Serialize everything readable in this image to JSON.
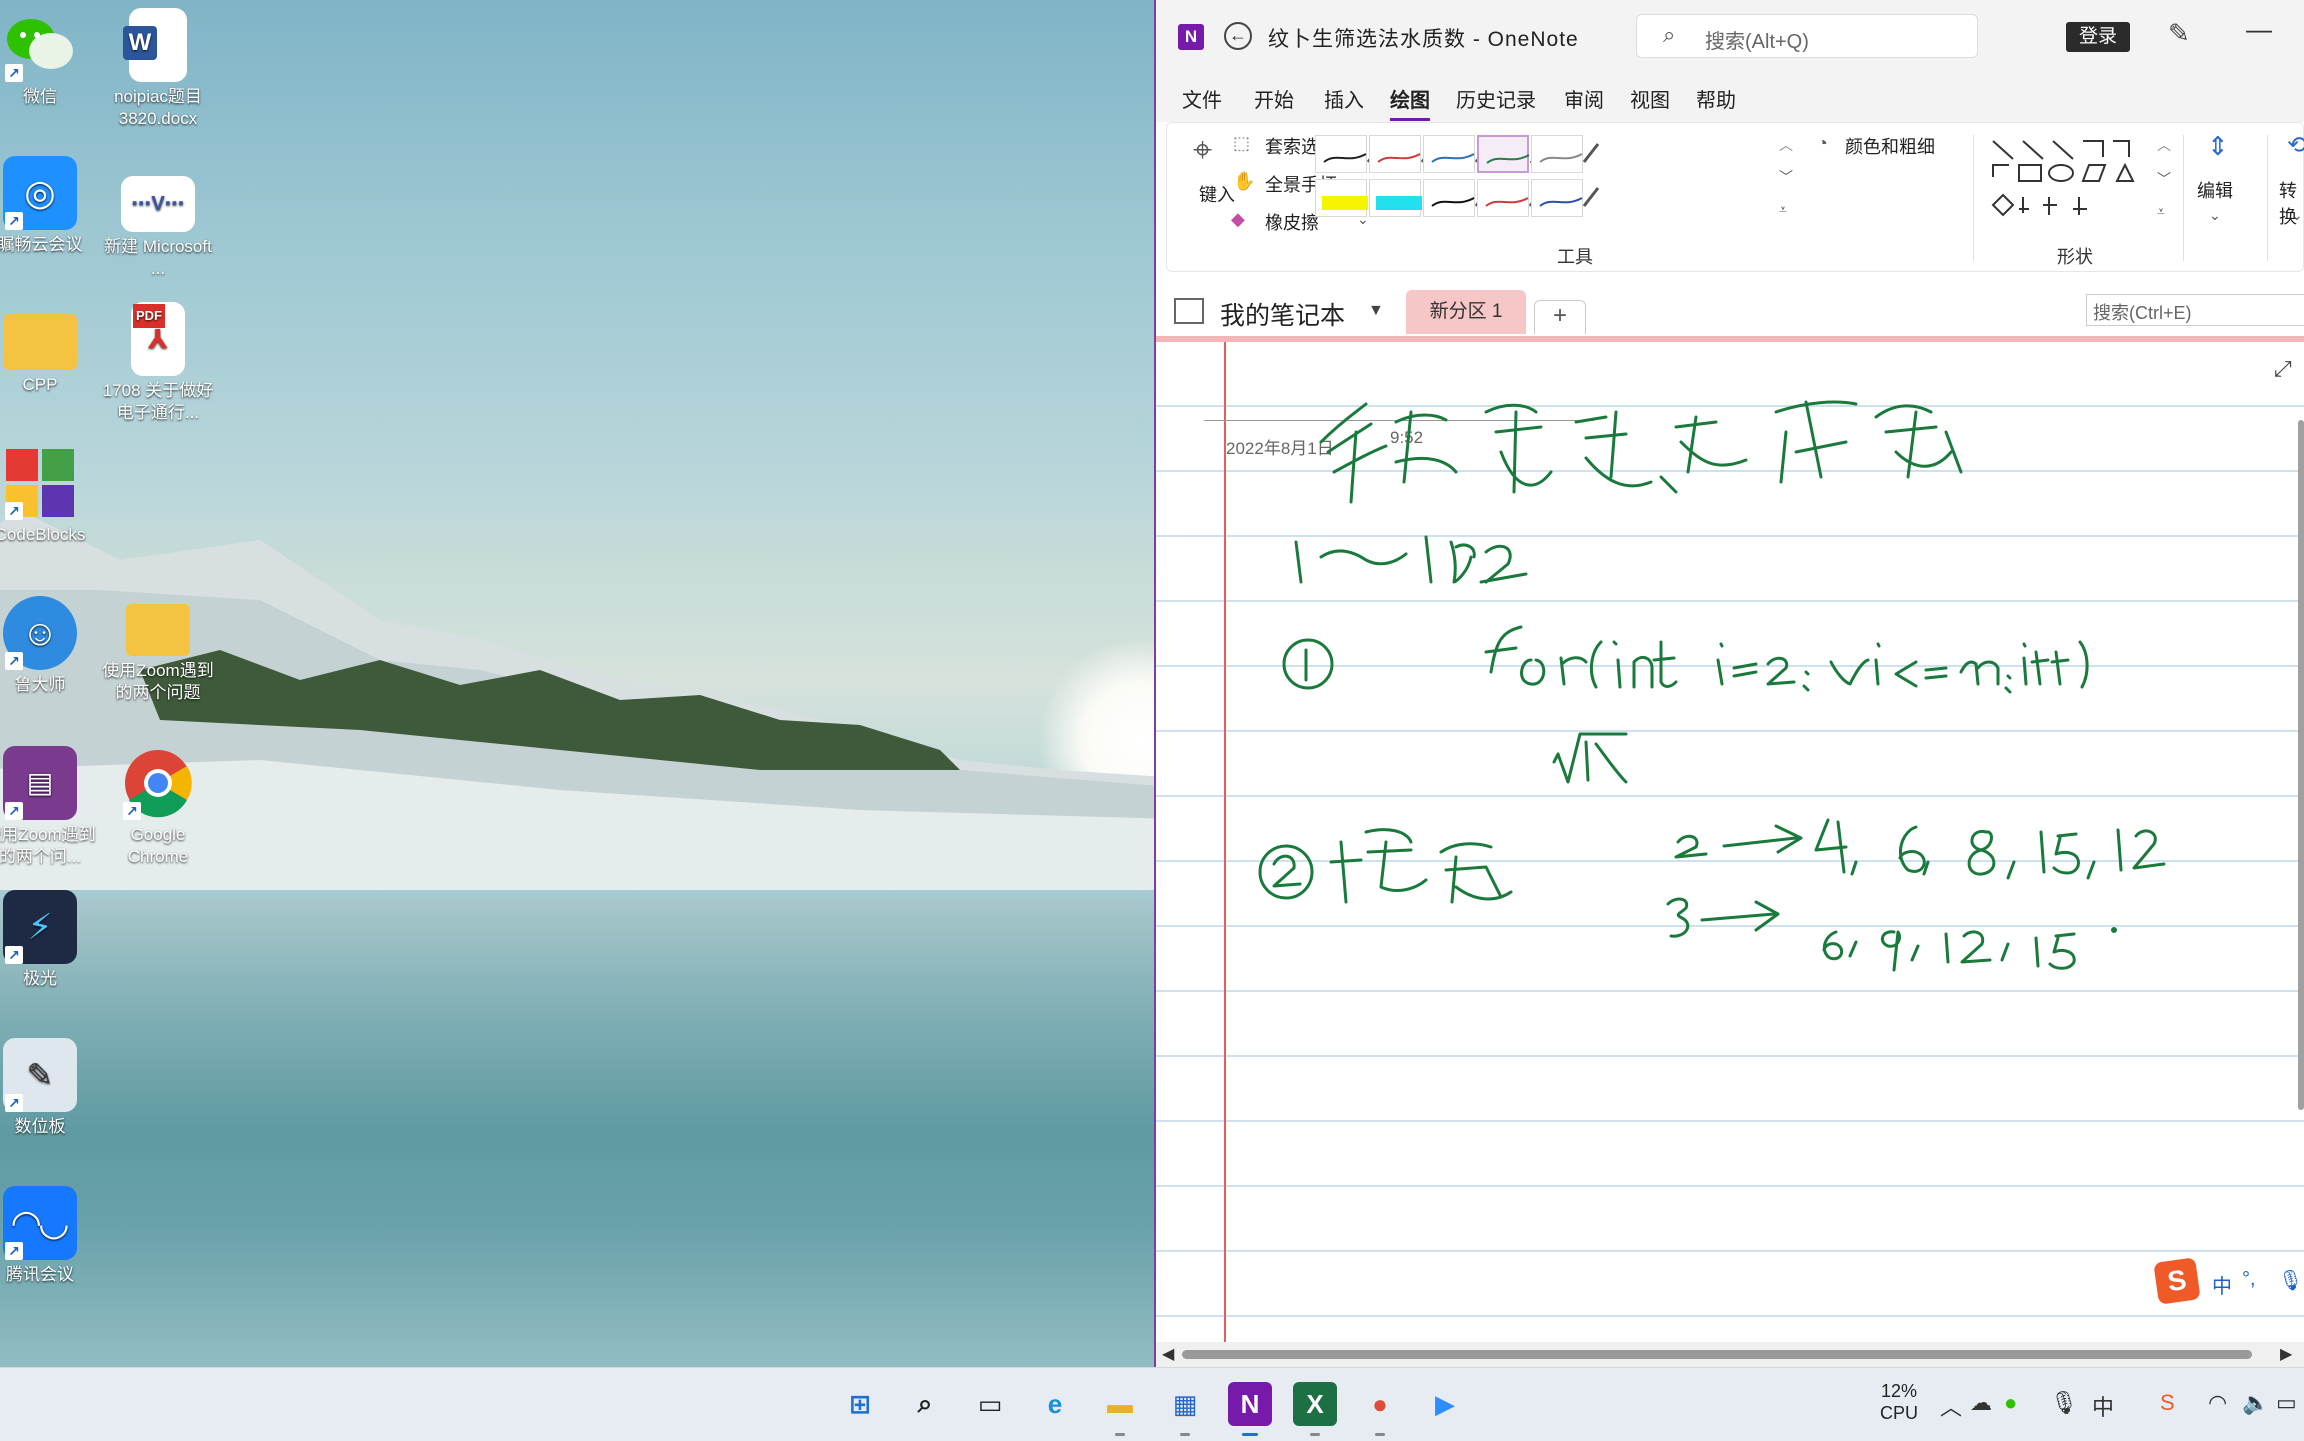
{
  "desktop": {
    "icons": [
      {
        "label": "微信",
        "glyph": "wechat-icon",
        "color": "#2dc100"
      },
      {
        "label": "noipiac题目3820.docx",
        "glyph": "word-doc-icon",
        "color": "#2b579a"
      },
      {
        "label": "瞩畅云会议",
        "glyph": "meeting-app-icon",
        "color": "#1e90ff"
      },
      {
        "label": "新建 Microsoft ...",
        "glyph": "visio-doc-icon",
        "color": "#3955a3"
      },
      {
        "label": "CPP",
        "glyph": "folder-icon",
        "color": "#f5c342"
      },
      {
        "label": "1708 关于做好电子通行...",
        "glyph": "pdf-icon",
        "color": "#d9302b"
      },
      {
        "label": "CodeBlocks",
        "glyph": "codeblocks-icon",
        "color": "#d33"
      },
      {
        "label": "鲁大师",
        "glyph": "ludashi-icon",
        "color": "#2f8be0"
      },
      {
        "label": "使用Zoom遇到的两个问题",
        "glyph": "folder-icon",
        "color": "#f5c342"
      },
      {
        "label": "使用Zoom遇到的两个问...",
        "glyph": "winrar-icon",
        "color": "#7a3b8f"
      },
      {
        "label": "Google Chrome",
        "glyph": "chrome-icon",
        "color": "#1a73e8"
      },
      {
        "label": "极光",
        "glyph": "jiguang-icon",
        "color": "#1565c0"
      },
      {
        "label": "数位板",
        "glyph": "tablet-icon",
        "color": "#3a7bd5"
      },
      {
        "label": "腾讯会议",
        "glyph": "tencent-meeting-icon",
        "color": "#1677ff"
      }
    ]
  },
  "onenote": {
    "logo": "N",
    "title": "纹卜生筛选法水质数 - OneNote",
    "search_placeholder": "搜索(Alt+Q)",
    "signin": "登录",
    "menu": [
      "文件",
      "开始",
      "插入",
      "绘图",
      "历史记录",
      "审阅",
      "视图",
      "帮助"
    ],
    "active_menu": "绘图",
    "ribbon": {
      "type_label": "键入",
      "lasso": "套索选择",
      "pan": "全景手柄",
      "eraser": "橡皮擦",
      "tools_group": "工具",
      "color_thickness": "颜色和粗细",
      "shapes_group": "形状",
      "edit": "编辑",
      "convert": "转换",
      "pens": [
        {
          "color": "#222222",
          "selected": false
        },
        {
          "color": "#d03a3a",
          "selected": false
        },
        {
          "color": "#2f6fb8",
          "selected": false
        },
        {
          "color": "#2a7a4a",
          "selected": true
        },
        {
          "color": "#888888",
          "selected": false
        },
        {
          "color": "#f5f500",
          "selected": false,
          "highlighter": true
        },
        {
          "color": "#22e0ee",
          "selected": false,
          "highlighter": true
        },
        {
          "color": "#111111",
          "selected": false
        },
        {
          "color": "#d03a3a",
          "selected": false
        },
        {
          "color": "#2f4fa8",
          "selected": false
        }
      ]
    },
    "notebook": "我的笔记本",
    "section": "新分区 1",
    "add_section": "+",
    "page_search": "搜索(Ctrl+E)",
    "page": {
      "date": "2022年8月1日",
      "time": "9:52",
      "ink_color": "#1a7a3c"
    }
  },
  "taskbar": {
    "cpu_value": "12%",
    "cpu_label": "CPU",
    "ime_zh": "中",
    "apps": [
      {
        "name": "start-button",
        "glyph": "⊞",
        "color": "#1f6fd1"
      },
      {
        "name": "search-icon",
        "glyph": "⌕",
        "color": "#222"
      },
      {
        "name": "task-view-icon",
        "glyph": "▭",
        "color": "#222"
      },
      {
        "name": "edge-icon",
        "glyph": "e",
        "color": "#1b8fd6"
      },
      {
        "name": "file-explorer-icon",
        "glyph": "▬",
        "color": "#e8b02f"
      },
      {
        "name": "store-icon",
        "glyph": "▦",
        "color": "#2766c4"
      },
      {
        "name": "onenote-icon",
        "glyph": "N",
        "color": "#7719aa"
      },
      {
        "name": "excel-icon",
        "glyph": "X",
        "color": "#1d7044"
      },
      {
        "name": "chrome-icon",
        "glyph": "●",
        "color": "#dd4b39"
      },
      {
        "name": "zoom-icon",
        "glyph": "▶",
        "color": "#2d8cff"
      }
    ]
  }
}
